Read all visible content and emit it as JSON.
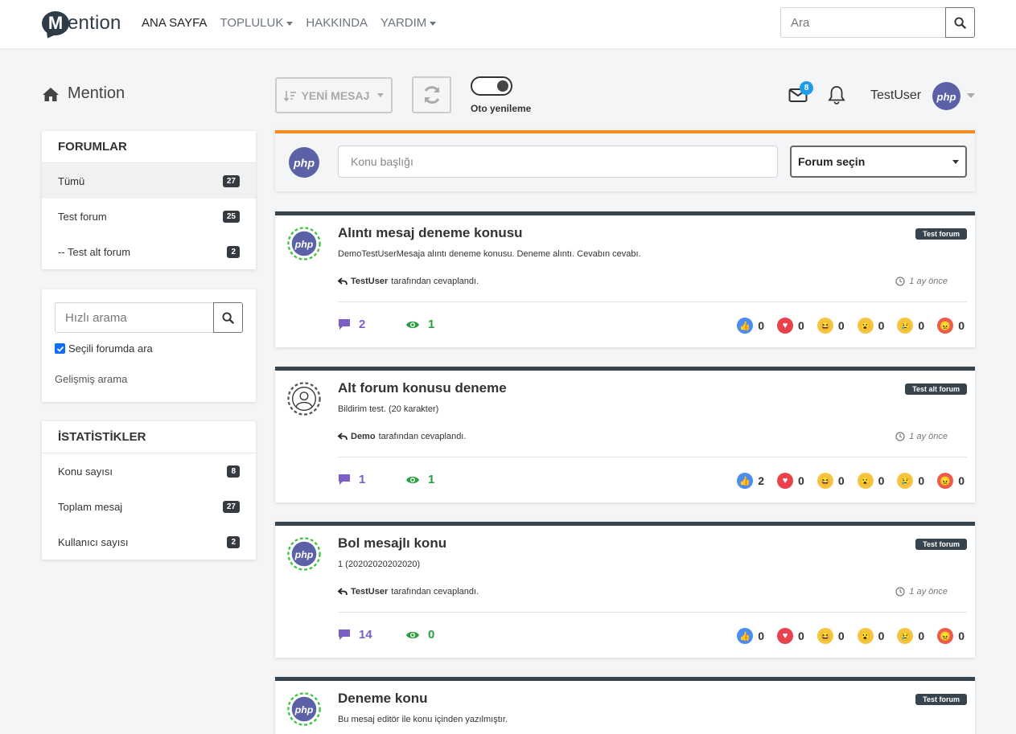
{
  "app": {
    "logo_letter": "M",
    "logo_text": "ention"
  },
  "nav": {
    "links": [
      {
        "label": "ANA SAYFA",
        "active": true,
        "dropdown": false
      },
      {
        "label": "TOPLULUK",
        "active": false,
        "dropdown": true
      },
      {
        "label": "HAKKINDA",
        "active": false,
        "dropdown": false
      },
      {
        "label": "YARDIM",
        "active": false,
        "dropdown": true
      }
    ],
    "search_placeholder": "Ara"
  },
  "breadcrumb": {
    "label": "Mention"
  },
  "toolbar": {
    "new_message_label": "YENİ MESAJ",
    "auto_refresh_label": "Oto yenileme",
    "mail_count": "8",
    "username": "TestUser",
    "avatar_text": "php"
  },
  "sidebar": {
    "forums": {
      "title": "FORUMLAR",
      "items": [
        {
          "label": "Tümü",
          "count": "27",
          "active": true
        },
        {
          "label": "Test forum",
          "count": "25",
          "active": false
        },
        {
          "label": "-- Test alt forum",
          "count": "2",
          "active": false
        }
      ]
    },
    "search": {
      "placeholder": "Hızlı arama",
      "checkbox_label": "Seçili forumda ara",
      "checked": true,
      "advanced_label": "Gelişmiş arama"
    },
    "stats": {
      "title": "İSTATİSTİKLER",
      "items": [
        {
          "label": "Konu sayısı",
          "count": "8"
        },
        {
          "label": "Toplam mesaj",
          "count": "27"
        },
        {
          "label": "Kullanıcı sayısı",
          "count": "2"
        }
      ]
    }
  },
  "new_topic": {
    "title_placeholder": "Konu başlığı",
    "forum_select_label": "Forum seçin",
    "avatar_text": "php"
  },
  "topics": [
    {
      "title": "Alıntı mesaj deneme konusu",
      "excerpt": "DemoTestUserMesaja alıntı deneme konusu. Deneme alıntı. Cevabın cevabı.",
      "forum": "Test forum",
      "reply_user": "TestUser",
      "reply_suffix": "tarafından cevaplandı.",
      "time": "1 ay önce",
      "comments": "2",
      "views": "1",
      "avatar": "php",
      "reactions": [
        "0",
        "0",
        "0",
        "0",
        "0",
        "0"
      ]
    },
    {
      "title": "Alt forum konusu deneme",
      "excerpt": "Bildirim test. (20 karakter)",
      "forum": "Test alt forum",
      "reply_user": "Demo",
      "reply_suffix": "tarafından cevaplandı.",
      "time": "1 ay önce",
      "comments": "1",
      "views": "1",
      "avatar": "user",
      "reactions": [
        "2",
        "0",
        "0",
        "0",
        "0",
        "0"
      ]
    },
    {
      "title": "Bol mesajlı konu",
      "excerpt": "1 (20202020202020)",
      "forum": "Test forum",
      "reply_user": "TestUser",
      "reply_suffix": "tarafından cevaplandı.",
      "time": "1 ay önce",
      "comments": "14",
      "views": "0",
      "avatar": "php",
      "reactions": [
        "0",
        "0",
        "0",
        "0",
        "0",
        "0"
      ]
    },
    {
      "title": "Deneme konu",
      "excerpt": "Bu mesaj editör ile konu içinden yazılmıştır.",
      "forum": "Test forum",
      "avatar": "php"
    }
  ],
  "reaction_types": [
    "like-icon",
    "heart-icon",
    "laugh-icon",
    "wow-icon",
    "sad-icon",
    "angry-icon"
  ],
  "colors": {
    "accent_orange": "#f28c1e",
    "topic_border": "#37434d",
    "comment_color": "#7b5fc7",
    "view_color": "#2a9d3f",
    "php_purple": "#5b61a6"
  }
}
